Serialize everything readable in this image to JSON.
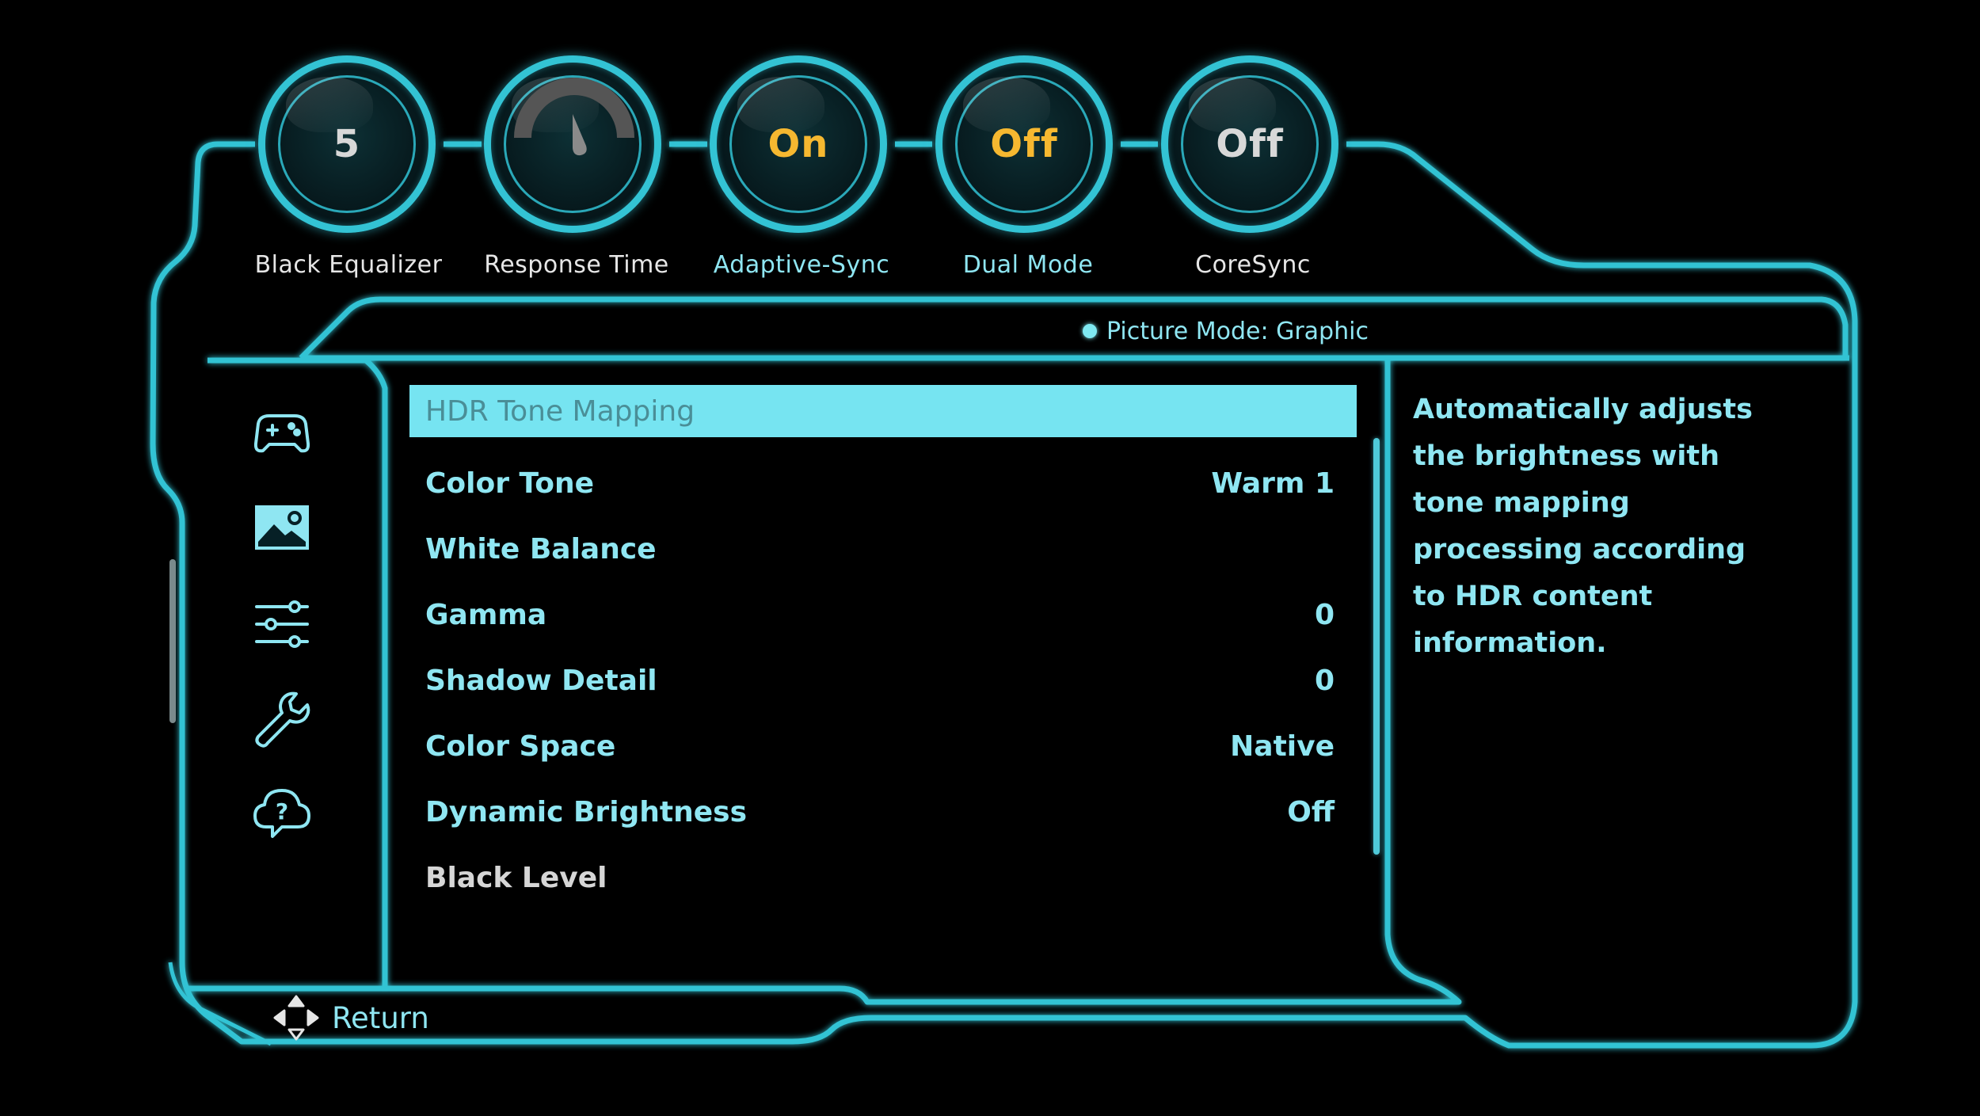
{
  "quick_settings": [
    {
      "id": "black-equalizer",
      "label": "Black Equalizer",
      "value": "5",
      "value_color": "#d8d8d8",
      "label_color": "#e6e6e6"
    },
    {
      "id": "response-time",
      "label": "Response Time",
      "value": "",
      "value_color": "#d8d8d8",
      "label_color": "#e6e6e6"
    },
    {
      "id": "adaptive-sync",
      "label": "Adaptive-Sync",
      "value": "On",
      "value_color": "#f6b830",
      "label_color": "#8fe6f2"
    },
    {
      "id": "dual-mode",
      "label": "Dual Mode",
      "value": "Off",
      "value_color": "#f6b830",
      "label_color": "#8fe6f2"
    },
    {
      "id": "coresync",
      "label": "CoreSync",
      "value": "Off",
      "value_color": "#d8d8d8",
      "label_color": "#e6e6e6"
    }
  ],
  "picture_mode": "Picture  Mode:  Graphic",
  "sidebar": {
    "icons": [
      "gamepad-icon",
      "picture-icon",
      "sliders-icon",
      "wrench-icon",
      "cloud-help-icon"
    ],
    "selected_index": 1
  },
  "menu": {
    "items": [
      {
        "label": "HDR  Tone  Mapping",
        "value": "",
        "selected": true
      },
      {
        "label": "Color  Tone",
        "value": "Warm  1"
      },
      {
        "label": "White  Balance",
        "value": ""
      },
      {
        "label": "Gamma",
        "value": "0"
      },
      {
        "label": "Shadow  Detail",
        "value": "0"
      },
      {
        "label": "Color  Space",
        "value": "Native"
      },
      {
        "label": "Dynamic  Brightness",
        "value": "Off"
      },
      {
        "label": "Black  Level",
        "value": "",
        "dim": true
      }
    ]
  },
  "description": "Automatically  adjusts  the brightness  with  tone mapping  processing according  to  HDR  content information.",
  "footer": {
    "return_label": "Return"
  },
  "colors": {
    "accent": "#33c3d4",
    "highlight": "#76e4f1",
    "text": "#8fe6f2",
    "value_orange": "#f6b830"
  }
}
